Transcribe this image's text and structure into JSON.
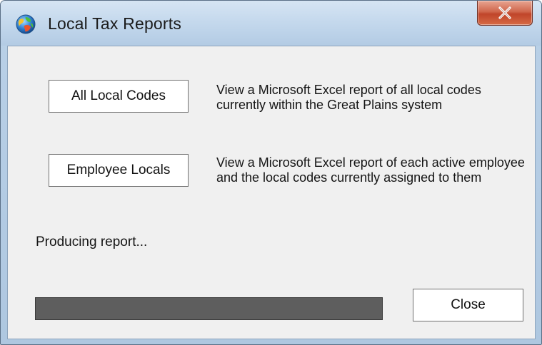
{
  "window": {
    "title": "Local Tax Reports",
    "close_glyph": "X",
    "icon": "app-globe-icon"
  },
  "reports": {
    "all_local_codes": {
      "button_label": "All Local Codes",
      "description": "View a Microsoft Excel report of all local codes currently within the Great Plains system"
    },
    "employee_locals": {
      "button_label": "Employee Locals",
      "description": "View a Microsoft Excel report of each active employee and the local codes currently assigned to them"
    }
  },
  "status": {
    "text": "Producing report...",
    "progress_fraction": 1.0
  },
  "footer": {
    "close_label": "Close"
  },
  "colors": {
    "progress_fill": "#5e5e5e",
    "close_button_red": "#c0452a",
    "titlebar_blue": "#c5d9ed"
  }
}
